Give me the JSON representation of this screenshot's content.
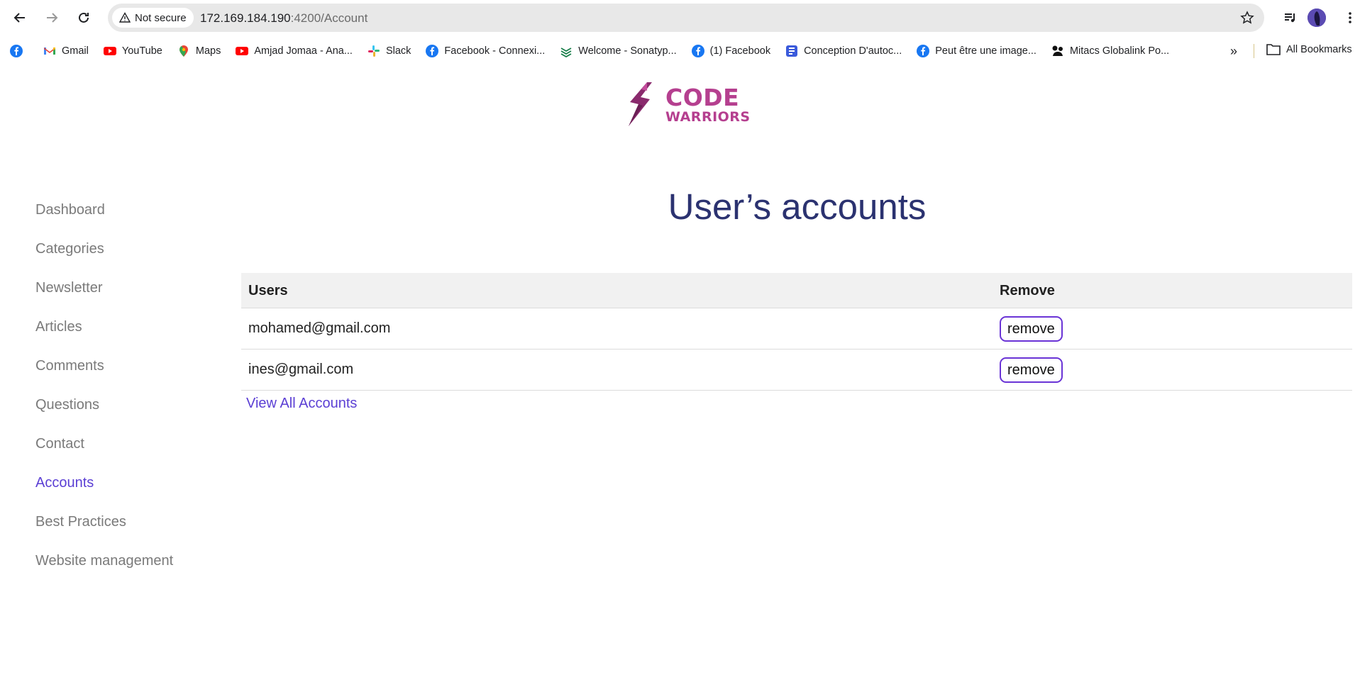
{
  "browser": {
    "security_chip": "Not secure",
    "url_host": "172.169.184.190",
    "url_rest": ":4200/Account",
    "bookmarks": [
      {
        "label": "",
        "icon": "facebook-icon"
      },
      {
        "label": "Gmail",
        "icon": "gmail-icon"
      },
      {
        "label": "YouTube",
        "icon": "youtube-icon"
      },
      {
        "label": "Maps",
        "icon": "maps-icon"
      },
      {
        "label": "Amjad Jomaa - Ana...",
        "icon": "youtube-icon"
      },
      {
        "label": "Slack",
        "icon": "slack-icon"
      },
      {
        "label": "Facebook - Connexi...",
        "icon": "facebook-icon"
      },
      {
        "label": "Welcome - Sonatyp...",
        "icon": "sonatype-icon"
      },
      {
        "label": "(1) Facebook",
        "icon": "facebook-icon"
      },
      {
        "label": "Conception D'autoc...",
        "icon": "forms-icon"
      },
      {
        "label": "Peut être une image...",
        "icon": "facebook-icon"
      },
      {
        "label": "Mitacs Globalink Po...",
        "icon": "mitacs-icon"
      }
    ],
    "more_bookmarks": "»",
    "all_bookmarks": "All Bookmarks"
  },
  "logo": {
    "line1": "CODE",
    "line2": "WARRIORS"
  },
  "sidebar": {
    "items": [
      {
        "label": "Dashboard",
        "active": false
      },
      {
        "label": "Categories",
        "active": false
      },
      {
        "label": "Newsletter",
        "active": false
      },
      {
        "label": "Articles",
        "active": false
      },
      {
        "label": "Comments",
        "active": false
      },
      {
        "label": "Questions",
        "active": false
      },
      {
        "label": "Contact",
        "active": false
      },
      {
        "label": "Accounts",
        "active": true
      },
      {
        "label": "Best Practices",
        "active": false
      },
      {
        "label": "Website management",
        "active": false
      }
    ]
  },
  "main": {
    "title": "User’s accounts",
    "table": {
      "headers": {
        "users": "Users",
        "remove": "Remove"
      },
      "rows": [
        {
          "email": "mohamed@gmail.com",
          "action": "remove"
        },
        {
          "email": "ines@gmail.com",
          "action": "remove"
        }
      ]
    },
    "view_all": "View All Accounts"
  },
  "colors": {
    "accent": "#5b3fd4",
    "title": "#2b3270",
    "logo": "#b53f8f",
    "button_border": "#6a34d6"
  }
}
